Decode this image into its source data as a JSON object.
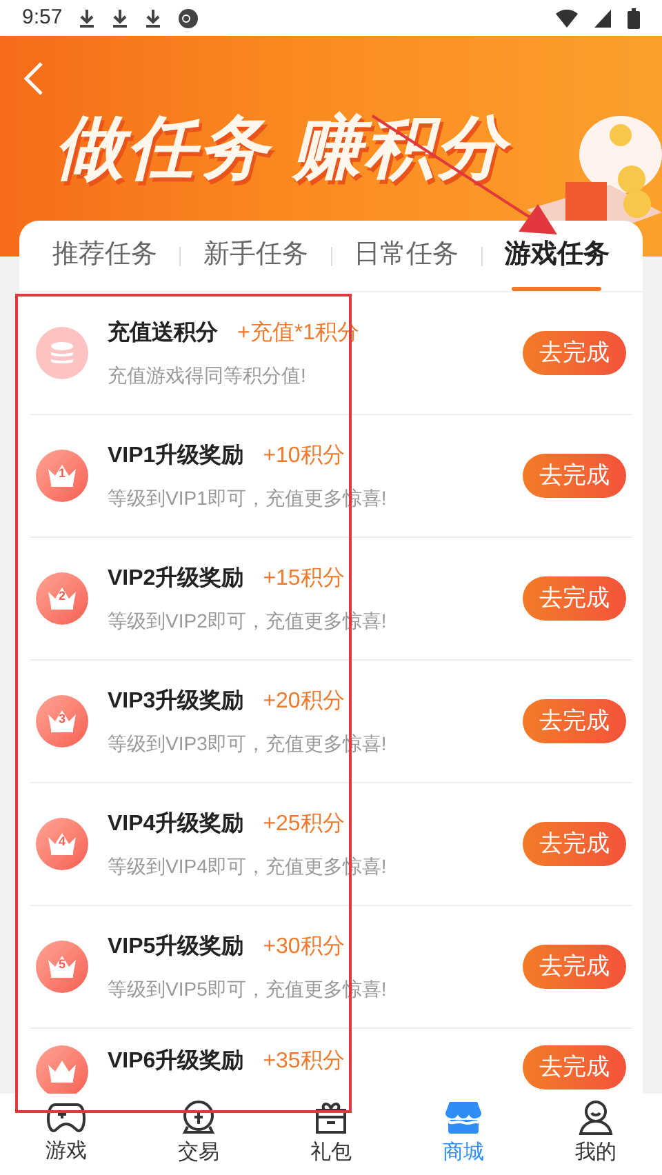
{
  "status_bar": {
    "time": "9:57"
  },
  "banner": {
    "title": "做任务 赚积分"
  },
  "tabs": [
    {
      "label": "推荐任务",
      "selected": false
    },
    {
      "label": "新手任务",
      "selected": false
    },
    {
      "label": "日常任务",
      "selected": false
    },
    {
      "label": "游戏任务",
      "selected": true
    }
  ],
  "tasks": [
    {
      "kind": "coins",
      "title": "充值送积分",
      "points": "+充值*1积分",
      "description": "充值游戏得同等积分值!",
      "button": "去完成"
    },
    {
      "kind": "crown",
      "badge": "1",
      "title": "VIP1升级奖励",
      "points": "+10积分",
      "description": "等级到VIP1即可，充值更多惊喜!",
      "button": "去完成"
    },
    {
      "kind": "crown",
      "badge": "2",
      "title": "VIP2升级奖励",
      "points": "+15积分",
      "description": "等级到VIP2即可，充值更多惊喜!",
      "button": "去完成"
    },
    {
      "kind": "crown",
      "badge": "3",
      "title": "VIP3升级奖励",
      "points": "+20积分",
      "description": "等级到VIP3即可，充值更多惊喜!",
      "button": "去完成"
    },
    {
      "kind": "crown",
      "badge": "4",
      "title": "VIP4升级奖励",
      "points": "+25积分",
      "description": "等级到VIP4即可，充值更多惊喜!",
      "button": "去完成"
    },
    {
      "kind": "crown",
      "badge": "5",
      "title": "VIP5升级奖励",
      "points": "+30积分",
      "description": "等级到VIP5即可，充值更多惊喜!",
      "button": "去完成"
    },
    {
      "kind": "crown",
      "title": "VIP6升级奖励",
      "points": "+35积分",
      "button": "去完成"
    }
  ],
  "bottom_nav": [
    {
      "kind": "gamepad",
      "label": "游戏",
      "selected": false
    },
    {
      "kind": "trade",
      "label": "交易",
      "selected": false
    },
    {
      "kind": "gift",
      "label": "礼包",
      "selected": false
    },
    {
      "kind": "store",
      "label": "商城",
      "selected": true
    },
    {
      "kind": "user",
      "label": "我的",
      "selected": false
    }
  ]
}
